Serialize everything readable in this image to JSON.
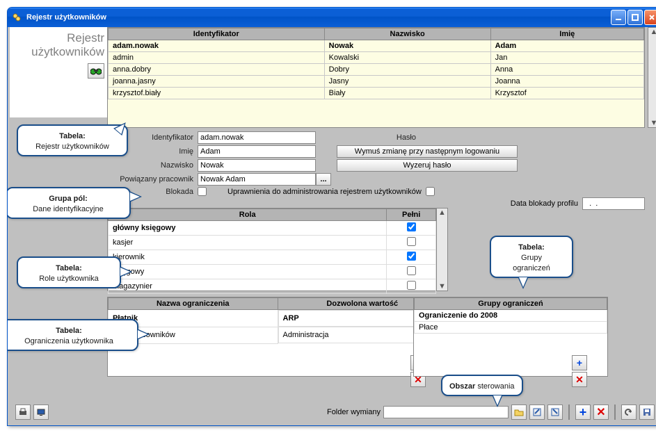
{
  "window": {
    "title": "Rejestr użytkowników"
  },
  "sidebar": {
    "line1": "Rejestr",
    "line2": "użytkowników"
  },
  "users_table": {
    "headers": [
      "Identyfikator",
      "Nazwisko",
      "Imię"
    ],
    "rows": [
      {
        "id": "adam.nowak",
        "last": "Nowak",
        "first": "Adam",
        "sel": true
      },
      {
        "id": "admin",
        "last": "Kowalski",
        "first": "Jan"
      },
      {
        "id": "anna.dobry",
        "last": "Dobry",
        "first": "Anna"
      },
      {
        "id": "joanna.jasny",
        "last": "Jasny",
        "first": "Joanna"
      },
      {
        "id": "krzysztof.biały",
        "last": "Biały",
        "first": "Krzysztof"
      }
    ]
  },
  "fields": {
    "identyfikator_lbl": "Identyfikator",
    "identyfikator_val": "adam.nowak",
    "imie_lbl": "Imię",
    "imie_val": "Adam",
    "nazwisko_lbl": "Nazwisko",
    "nazwisko_val": "Nowak",
    "powiazany_lbl": "Powiązany pracownik",
    "powiazany_val": "Nowak Adam",
    "blokada_lbl": "Blokada",
    "uprawnienia_lbl": "Uprawnienia do administrowania rejestrem użytkowników",
    "data_blokady_lbl": "Data blokady profilu",
    "data_blokady_val": "  .  .",
    "haslo_lbl": "Hasło",
    "wymus_btn": "Wymuś zmianę przy następnym logowaniu",
    "wyzeruj_btn": "Wyzeruj hasło"
  },
  "roles": {
    "headers": [
      "Rola",
      "Pełni"
    ],
    "rows": [
      {
        "name": "główny księgowy",
        "checked": true,
        "sel": true
      },
      {
        "name": "kasjer",
        "checked": false
      },
      {
        "name": "kierownik",
        "checked": true
      },
      {
        "name": "księgowy",
        "checked": false
      },
      {
        "name": "magazynier",
        "checked": false
      }
    ]
  },
  "restrictions": {
    "headers": [
      "Nazwa ograniczenia",
      "Dozwolona wartość"
    ],
    "rows": [
      {
        "name": "Płatnik",
        "value": "ARP",
        "sel": true
      },
      {
        "name": "Typy pracowników",
        "value": "Administracja"
      }
    ]
  },
  "groups": {
    "header": "Grupy ograniczeń",
    "rows": [
      {
        "name": "Ograniczenie do 2008",
        "sel": true
      },
      {
        "name": "Płace"
      }
    ]
  },
  "bottom": {
    "folder_lbl": "Folder wymiany"
  },
  "callouts": {
    "c1_b": "Tabela:",
    "c1_t": "Rejestr użytkowników",
    "c2_b": "Grupa pól:",
    "c2_t": "Dane identyfikacyjne",
    "c3_b": "Tabela:",
    "c3_t": "Role użytkownika",
    "c4_b": "Tabela:",
    "c4_t": "Ograniczenia użytkownika",
    "c5_b": "Tabela:",
    "c5_t": "Grupy\nograniczeń",
    "c6_b": "Obszar",
    "c6_t": " sterowania"
  }
}
